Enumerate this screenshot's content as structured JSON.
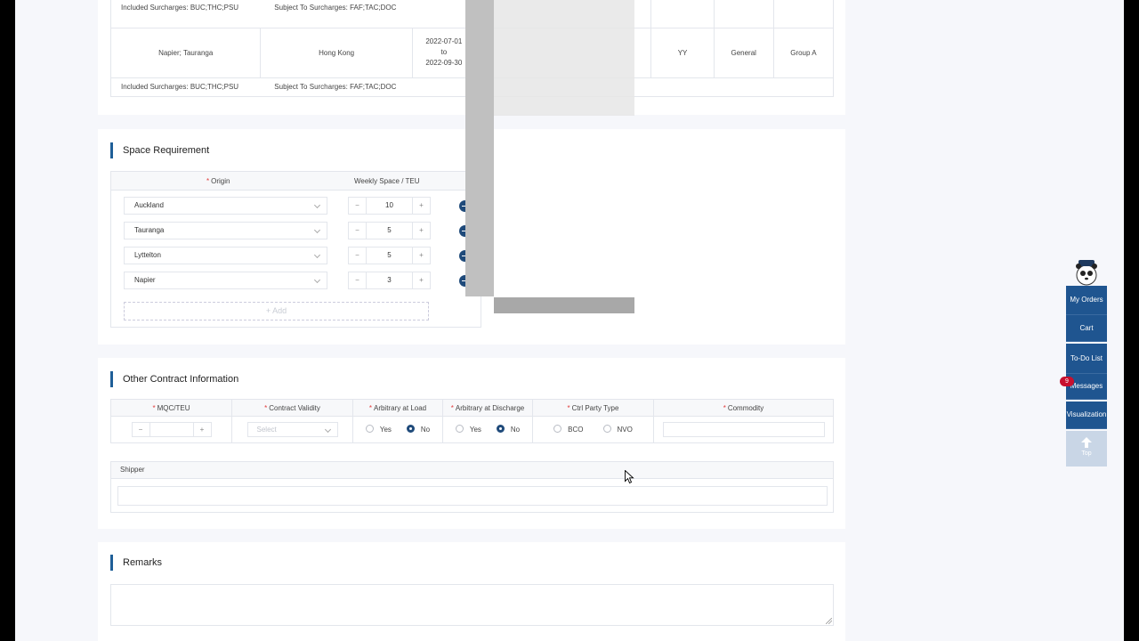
{
  "rates": {
    "row1_included": "Included Surcharges: BUC;THC;PSU",
    "row1_subject": "Subject To Surcharges: FAF;TAC;DOC",
    "row2": {
      "route_from": "Napier; Tauranga",
      "route_to": "Hong Kong",
      "date_from": "2022-07-01",
      "date_to_word": "to",
      "date_to": "2022-09-30",
      "col_yy": "YY",
      "col_type": "General",
      "col_group": "Group A"
    },
    "row2_included": "Included Surcharges: BUC;THC;PSU",
    "row2_subject": "Subject To Surcharges: FAF;TAC;DOC"
  },
  "space": {
    "title": "Space Requirement",
    "origin_header": "Origin",
    "weekly_header": "Weekly Space / TEU",
    "rows": [
      {
        "origin": "Auckland",
        "teu": "10"
      },
      {
        "origin": "Tauranga",
        "teu": "5"
      },
      {
        "origin": "Lyttelton",
        "teu": "5"
      },
      {
        "origin": "Napier",
        "teu": "3"
      }
    ],
    "minus": "−",
    "plus": "+",
    "add_label": "+ Add"
  },
  "other": {
    "title": "Other Contract Information",
    "headers": {
      "mqc": "MQC/TEU",
      "validity": "Contract Validity",
      "arb_load": "Arbitrary at Load",
      "arb_discharge": "Arbitrary at Discharge",
      "ctrl_party": "Ctrl Party Type",
      "commodity": "Commodity"
    },
    "validity_placeholder": "Select",
    "yes": "Yes",
    "no": "No",
    "bco": "BCO",
    "nvo": "NVO",
    "shipper_label": "Shipper"
  },
  "remarks": {
    "title": "Remarks"
  },
  "sidebar": {
    "my_orders": "My Orders",
    "cart": "Cart",
    "todo": "To-Do List",
    "messages": "Messages",
    "messages_count": "9",
    "visualization": "Visualization",
    "top": "Top"
  }
}
